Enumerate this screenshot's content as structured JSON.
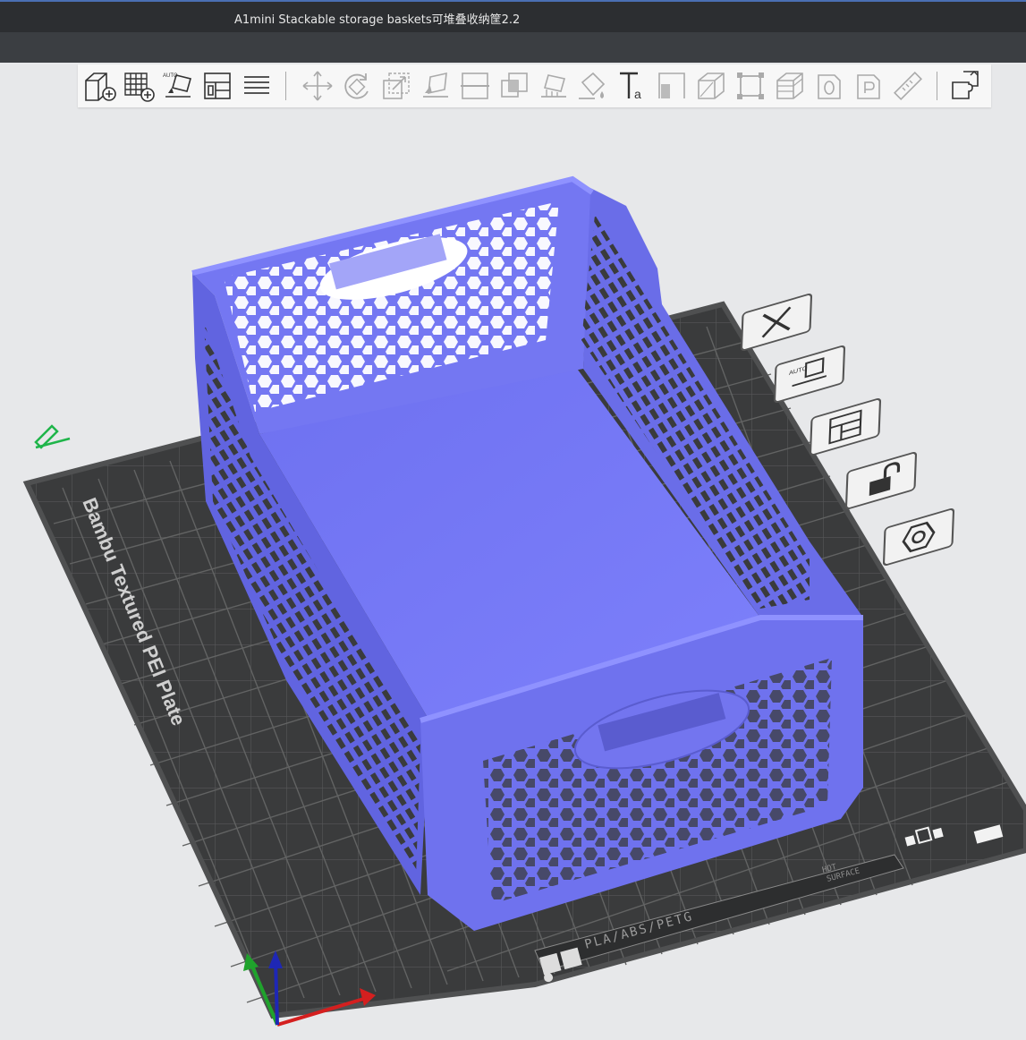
{
  "window": {
    "title": "A1mini Stackable storage baskets可堆叠收纳筐2.2"
  },
  "toolbar": {
    "groups": [
      [
        "add-object",
        "add-plate",
        "auto-orient",
        "arrange",
        "split-layers"
      ],
      [
        "move",
        "rotate",
        "scale",
        "lay-on-face",
        "cut",
        "boolean",
        "support-painting",
        "color-painting",
        "text-tool",
        "seam-painting",
        "mesh-boolean",
        "fit-to-box",
        "slice-layer",
        "variable-layer",
        "measure"
      ],
      [
        "assembly"
      ]
    ]
  },
  "plate": {
    "label": "Bambu Textured PEI Plate",
    "material_strip": "PLA/ABS/PETG",
    "hot_surface": [
      "HOT",
      "SURFACE"
    ]
  },
  "plate_controls": [
    "close-plate",
    "auto-orient-plate",
    "arrange-plate",
    "lock-plate",
    "plate-settings"
  ],
  "colors": {
    "accent": "#4a6fb3",
    "model": "#7b7ef6",
    "model_shadow": "#5a5cd4",
    "bed": "#3a3b3c",
    "grid": "#6b6b6b",
    "axis_x": "#d41f1f",
    "axis_y": "#1fa32c",
    "axis_z": "#1e27b5"
  }
}
